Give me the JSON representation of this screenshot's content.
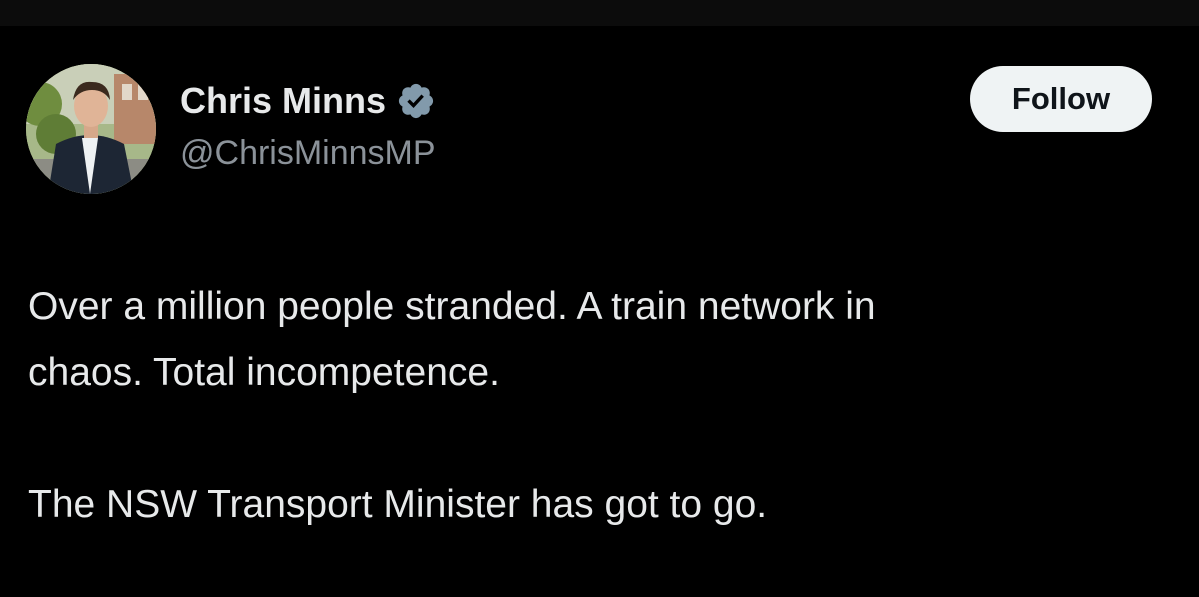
{
  "tweet": {
    "author": {
      "display_name": "Chris Minns",
      "handle": "@ChrisMinnsMP",
      "verified": true,
      "verified_badge_color": "#829aab"
    },
    "follow_button_label": "Follow",
    "text_lines": [
      "Over a million people stranded. A train network in",
      "chaos. Total incompetence.",
      "The NSW Transport Minister has got to go."
    ]
  },
  "colors": {
    "background": "#000000",
    "primary_text": "#e7e9ea",
    "secondary_text": "#8b9299",
    "button_background": "#eff3f4",
    "button_text": "#0f1419"
  }
}
